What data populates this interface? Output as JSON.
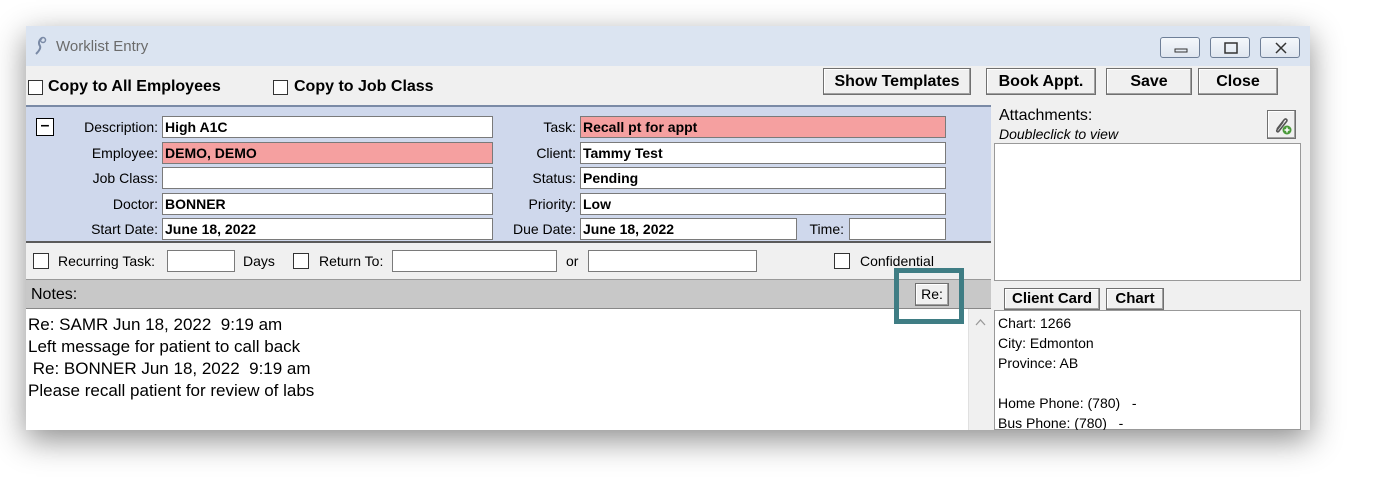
{
  "window": {
    "title": "Worklist Entry",
    "controls": [
      "minimize-icon",
      "maximize-icon",
      "close-icon"
    ]
  },
  "toolbar": {
    "copy_all_label": "Copy to All Employees",
    "copy_job_label": "Copy to Job Class",
    "show_templates_label": "Show Templates",
    "book_appt_label": "Book Appt.",
    "save_label": "Save",
    "close_label": "Close"
  },
  "form": {
    "collapse_symbol": "–",
    "description": {
      "label": "Description:",
      "value": "High A1C"
    },
    "employee": {
      "label": "Employee:",
      "value": "DEMO, DEMO"
    },
    "job_class": {
      "label": "Job Class:",
      "value": ""
    },
    "doctor": {
      "label": "Doctor:",
      "value": "BONNER"
    },
    "start_date": {
      "label": "Start Date:",
      "value": "June 18, 2022"
    },
    "task": {
      "label": "Task:",
      "value": "Recall pt for appt"
    },
    "client": {
      "label": "Client:",
      "value": "Tammy Test"
    },
    "status": {
      "label": "Status:",
      "value": "Pending"
    },
    "priority": {
      "label": "Priority:",
      "value": "Low"
    },
    "due_date": {
      "label": "Due Date:",
      "value": "June 18, 2022"
    },
    "time": {
      "label": "Time:",
      "value": ""
    }
  },
  "recurring": {
    "recurring_label": "Recurring Task:",
    "recurring_value": "",
    "days_label": "Days",
    "return_label": "Return To:",
    "return_value": "",
    "or_label": "or",
    "or_value": "",
    "confidential_label": "Confidential"
  },
  "notes": {
    "header": "Notes:",
    "re_button": "Re:",
    "lines": [
      "Re: SAMR Jun 18, 2022  9:19 am",
      "Left message for patient to call back",
      " Re: BONNER Jun 18, 2022  9:19 am",
      "Please recall patient for review of labs"
    ]
  },
  "attachments": {
    "title": "Attachments:",
    "hint": "Doubleclick to view",
    "add_icon": "paperclip-add-icon"
  },
  "client_panel": {
    "client_card_label": "Client Card",
    "chart_label": "Chart",
    "lines": [
      "Chart: 1266",
      "City: Edmonton",
      "Province: AB",
      "",
      "Home Phone: (780)   -",
      "Bus Phone: (780)   -"
    ]
  },
  "colors": {
    "panel_bg": "#cfd8ec",
    "required_field": "#f5a0a0",
    "highlight_border": "#3f7d84",
    "titlebar": "#dbe4f1"
  }
}
